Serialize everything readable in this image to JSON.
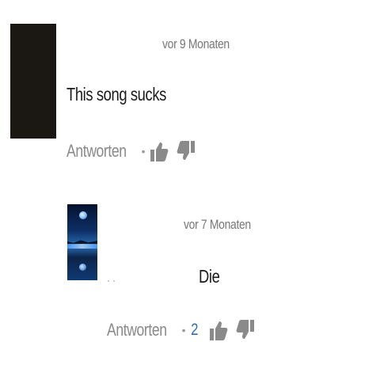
{
  "comments": [
    {
      "timestamp": "vor 9 Monaten",
      "text": "This song sucks",
      "reply_label": "Antworten",
      "separator": "•",
      "like_count": ""
    },
    {
      "timestamp": "vor 7 Monaten",
      "text": "Die",
      "reply_label": "Antworten",
      "separator": "•",
      "like_count": "2"
    }
  ],
  "icons": {
    "like": "thumbs-up-icon",
    "dislike": "thumbs-down-icon"
  },
  "colors": {
    "icon": "#8a8a8a",
    "like_count": "#2f6db5",
    "text": "#1a1a1a",
    "meta": "#777777"
  }
}
